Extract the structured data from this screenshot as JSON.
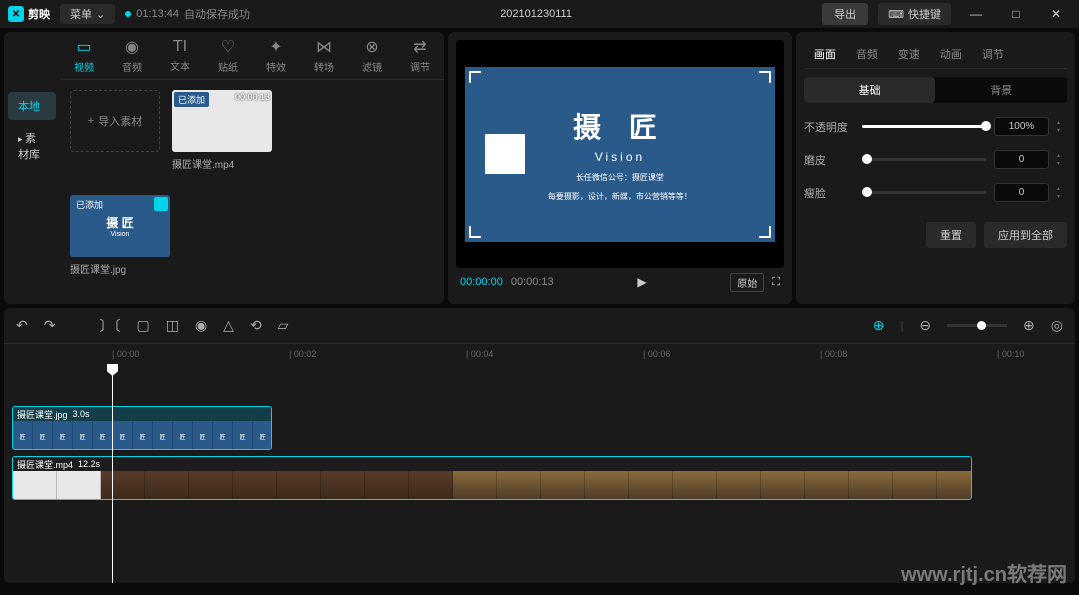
{
  "titlebar": {
    "app_name": "剪映",
    "menu": "菜单",
    "save_time": "01:13:44",
    "save_status": "自动保存成功",
    "project_name": "202101230111",
    "export": "导出",
    "shortcuts": "快捷键"
  },
  "top_tabs": [
    {
      "icon": "▭",
      "label": "视频",
      "active": true
    },
    {
      "icon": "◉",
      "label": "音频"
    },
    {
      "icon": "TI",
      "label": "文本"
    },
    {
      "icon": "♡",
      "label": "贴纸"
    },
    {
      "icon": "✦",
      "label": "特效"
    },
    {
      "icon": "⋈",
      "label": "转场"
    },
    {
      "icon": "⊗",
      "label": "滤镜"
    },
    {
      "icon": "⇄",
      "label": "调节"
    }
  ],
  "sidebar": {
    "local": "本地",
    "library": "素材库"
  },
  "media": {
    "import": "导入素材",
    "items": [
      {
        "name": "摄匠课堂.mp4",
        "badge": "已添加",
        "duration": "00:00:13",
        "type": "white"
      },
      {
        "name": "摄匠课堂.jpg",
        "badge": "已添加",
        "type": "blue"
      }
    ]
  },
  "preview": {
    "title_main": "摄 匠",
    "title_sub": "Vision",
    "small1": "长任微信公号：摄匠课堂",
    "small2": "每要摄影，设计，新媒，市公营销等等！",
    "time_current": "00:00:00",
    "time_duration": "00:00:13",
    "ratio": "原始"
  },
  "right_panel": {
    "tabs": [
      "画面",
      "音频",
      "变速",
      "动画",
      "调节"
    ],
    "subtabs": [
      "基础",
      "背景"
    ],
    "opacity_label": "不透明度",
    "opacity_value": "100%",
    "smooth_label": "磨皮",
    "smooth_value": "0",
    "slim_label": "瘦脸",
    "slim_value": "0",
    "reset": "重置",
    "apply_all": "应用到全部"
  },
  "timeline": {
    "ticks": [
      "00:00",
      "00:02",
      "00:04",
      "00:06",
      "00:08",
      "00:10"
    ],
    "clip1_name": "摄匠课堂.jpg",
    "clip1_dur": "3.0s",
    "clip2_name": "摄匠课堂.mp4",
    "clip2_dur": "12.2s"
  },
  "watermark": "www.rjtj.cn软荐网"
}
